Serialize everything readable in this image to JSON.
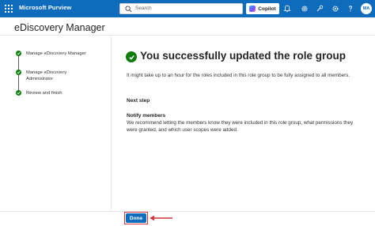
{
  "app": {
    "brand": "Microsoft Purview",
    "accent_color": "#0f6cbd"
  },
  "search": {
    "placeholder": "Search"
  },
  "topbar": {
    "copilot_label": "Copilot",
    "icons": [
      "bell-icon",
      "gear-outline-icon",
      "wrench-icon",
      "settings-icon",
      "help-icon"
    ],
    "avatar_initials": "MA"
  },
  "page": {
    "title": "eDiscovery Manager"
  },
  "steps": [
    {
      "label": "Manage eDiscovery Manager",
      "status": "complete"
    },
    {
      "label": "Manage eDiscovery",
      "label_line2": "Administrator",
      "status": "complete"
    },
    {
      "label": "Review and finish",
      "status": "complete"
    }
  ],
  "main": {
    "title": "You successfully updated the role group",
    "intro": "It might take up to an hour for the roles included in this role group to be fully assigned to all members.",
    "next_step_heading": "Next step",
    "notify_heading": "Notify members",
    "notify_text": "We recommend letting the members know they were included in this role group, what permissions they were granted, and which user scopes were added."
  },
  "footer": {
    "done_label": "Done",
    "highlight_color": "#d13438"
  },
  "colors": {
    "success": "#107c10"
  }
}
